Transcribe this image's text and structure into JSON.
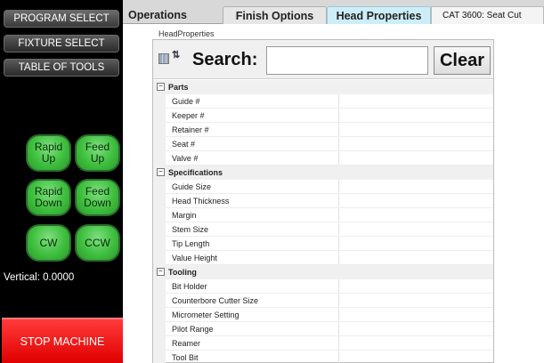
{
  "left_panel": {
    "nav": [
      {
        "label": "PROGRAM SELECT",
        "active": true
      },
      {
        "label": "FIXTURE SELECT"
      },
      {
        "label": "TABLE OF TOOLS"
      }
    ],
    "controls": [
      {
        "label": "Rapid\nUp"
      },
      {
        "label": "Feed\nUp"
      },
      {
        "label": "Rapid\nDown"
      },
      {
        "label": "Feed\nDown"
      },
      {
        "label": "CW"
      },
      {
        "label": "CCW"
      }
    ],
    "vertical_readout": "Vertical: 0.0000",
    "stop_label": "STOP MACHINE",
    "control_color": "#3fbf3f",
    "stop_color": "#e00000"
  },
  "tabs": {
    "operations": "Operations",
    "finish_options": "Finish Options",
    "head_properties": "Head Properties",
    "cat": "CAT 3600: Seat Cut"
  },
  "properties": {
    "title": "HeadProperties",
    "search_label": "Search:",
    "search_value": "",
    "clear_label": "Clear",
    "categories": [
      {
        "name": "Parts",
        "toggle": "−",
        "items": [
          "Guide #",
          "Keeper #",
          "Retainer #",
          "Seat #",
          "Valve #"
        ]
      },
      {
        "name": "Specifications",
        "toggle": "−",
        "items": [
          "Guide Size",
          "Head Thickness",
          "Margin",
          "Stem Size",
          "Tip Length",
          "Value Height"
        ]
      },
      {
        "name": "Tooling",
        "toggle": "−",
        "items": [
          "Bit Holder",
          "Counterbore Cutter Size",
          "Micrometer Setting",
          "Pilot Range",
          "Reamer",
          "Tool Bit"
        ]
      }
    ]
  }
}
